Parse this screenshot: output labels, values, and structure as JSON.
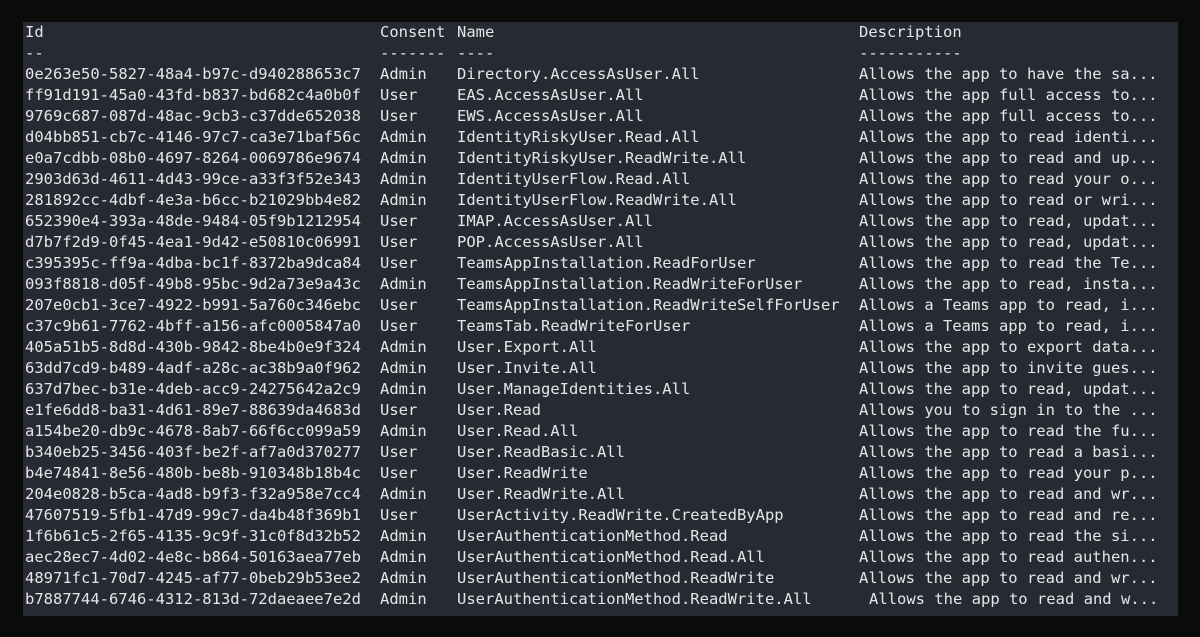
{
  "terminal": {
    "headers": {
      "id": "Id",
      "consent": "Consent",
      "name": "Name",
      "description": "Description"
    },
    "separators": {
      "id": "--",
      "consent": "-------",
      "name": "----",
      "description": "-----------"
    },
    "rows": [
      {
        "id": "0e263e50-5827-48a4-b97c-d940288653c7",
        "consent": "Admin",
        "name": "Directory.AccessAsUser.All",
        "description": "Allows the app to have the sa..."
      },
      {
        "id": "ff91d191-45a0-43fd-b837-bd682c4a0b0f",
        "consent": "User",
        "name": "EAS.AccessAsUser.All",
        "description": "Allows the app full access to..."
      },
      {
        "id": "9769c687-087d-48ac-9cb3-c37dde652038",
        "consent": "User",
        "name": "EWS.AccessAsUser.All",
        "description": "Allows the app full access to..."
      },
      {
        "id": "d04bb851-cb7c-4146-97c7-ca3e71baf56c",
        "consent": "Admin",
        "name": "IdentityRiskyUser.Read.All",
        "description": "Allows the app to read identi..."
      },
      {
        "id": "e0a7cdbb-08b0-4697-8264-0069786e9674",
        "consent": "Admin",
        "name": "IdentityRiskyUser.ReadWrite.All",
        "description": "Allows the app to read and up..."
      },
      {
        "id": "2903d63d-4611-4d43-99ce-a33f3f52e343",
        "consent": "Admin",
        "name": "IdentityUserFlow.Read.All",
        "description": "Allows the app to read your o..."
      },
      {
        "id": "281892cc-4dbf-4e3a-b6cc-b21029bb4e82",
        "consent": "Admin",
        "name": "IdentityUserFlow.ReadWrite.All",
        "description": "Allows the app to read or wri..."
      },
      {
        "id": "652390e4-393a-48de-9484-05f9b1212954",
        "consent": "User",
        "name": "IMAP.AccessAsUser.All",
        "description": "Allows the app to read, updat..."
      },
      {
        "id": "d7b7f2d9-0f45-4ea1-9d42-e50810c06991",
        "consent": "User",
        "name": "POP.AccessAsUser.All",
        "description": "Allows the app to read, updat..."
      },
      {
        "id": "c395395c-ff9a-4dba-bc1f-8372ba9dca84",
        "consent": "User",
        "name": "TeamsAppInstallation.ReadForUser",
        "description": "Allows the app to read the Te..."
      },
      {
        "id": "093f8818-d05f-49b8-95bc-9d2a73e9a43c",
        "consent": "Admin",
        "name": "TeamsAppInstallation.ReadWriteForUser",
        "description": "Allows the app to read, insta..."
      },
      {
        "id": "207e0cb1-3ce7-4922-b991-5a760c346ebc",
        "consent": "User",
        "name": "TeamsAppInstallation.ReadWriteSelfForUser",
        "description": "Allows a Teams app to read, i..."
      },
      {
        "id": "c37c9b61-7762-4bff-a156-afc0005847a0",
        "consent": "User",
        "name": "TeamsTab.ReadWriteForUser",
        "description": "Allows a Teams app to read, i..."
      },
      {
        "id": "405a51b5-8d8d-430b-9842-8be4b0e9f324",
        "consent": "Admin",
        "name": "User.Export.All",
        "description": "Allows the app to export data..."
      },
      {
        "id": "63dd7cd9-b489-4adf-a28c-ac38b9a0f962",
        "consent": "Admin",
        "name": "User.Invite.All",
        "description": "Allows the app to invite gues..."
      },
      {
        "id": "637d7bec-b31e-4deb-acc9-24275642a2c9",
        "consent": "Admin",
        "name": "User.ManageIdentities.All",
        "description": "Allows the app to read, updat..."
      },
      {
        "id": "e1fe6dd8-ba31-4d61-89e7-88639da4683d",
        "consent": "User",
        "name": "User.Read",
        "description": "Allows you to sign in to the ..."
      },
      {
        "id": "a154be20-db9c-4678-8ab7-66f6cc099a59",
        "consent": "Admin",
        "name": "User.Read.All",
        "description": "Allows the app to read the fu..."
      },
      {
        "id": "b340eb25-3456-403f-be2f-af7a0d370277",
        "consent": "User",
        "name": "User.ReadBasic.All",
        "description": "Allows the app to read a basi..."
      },
      {
        "id": "b4e74841-8e56-480b-be8b-910348b18b4c",
        "consent": "User",
        "name": "User.ReadWrite",
        "description": "Allows the app to read your p..."
      },
      {
        "id": "204e0828-b5ca-4ad8-b9f3-f32a958e7cc4",
        "consent": "Admin",
        "name": "User.ReadWrite.All",
        "description": "Allows the app to read and wr..."
      },
      {
        "id": "47607519-5fb1-47d9-99c7-da4b48f369b1",
        "consent": "User",
        "name": "UserActivity.ReadWrite.CreatedByApp",
        "description": "Allows the app to read and re..."
      },
      {
        "id": "1f6b61c5-2f65-4135-9c9f-31c0f8d32b52",
        "consent": "Admin",
        "name": "UserAuthenticationMethod.Read",
        "description": "Allows the app to read the si..."
      },
      {
        "id": "aec28ec7-4d02-4e8c-b864-50163aea77eb",
        "consent": "Admin",
        "name": "UserAuthenticationMethod.Read.All",
        "description": "Allows the app to read authen..."
      },
      {
        "id": "48971fc1-70d7-4245-af77-0beb29b53ee2",
        "consent": "Admin",
        "name": "UserAuthenticationMethod.ReadWrite",
        "description": "Allows the app to read and wr..."
      },
      {
        "id": "b7887744-6746-4312-813d-72daeaee7e2d",
        "consent": "Admin",
        "name": "UserAuthenticationMethod.ReadWrite.All",
        "description": "Allows the app to read and w..."
      }
    ]
  }
}
